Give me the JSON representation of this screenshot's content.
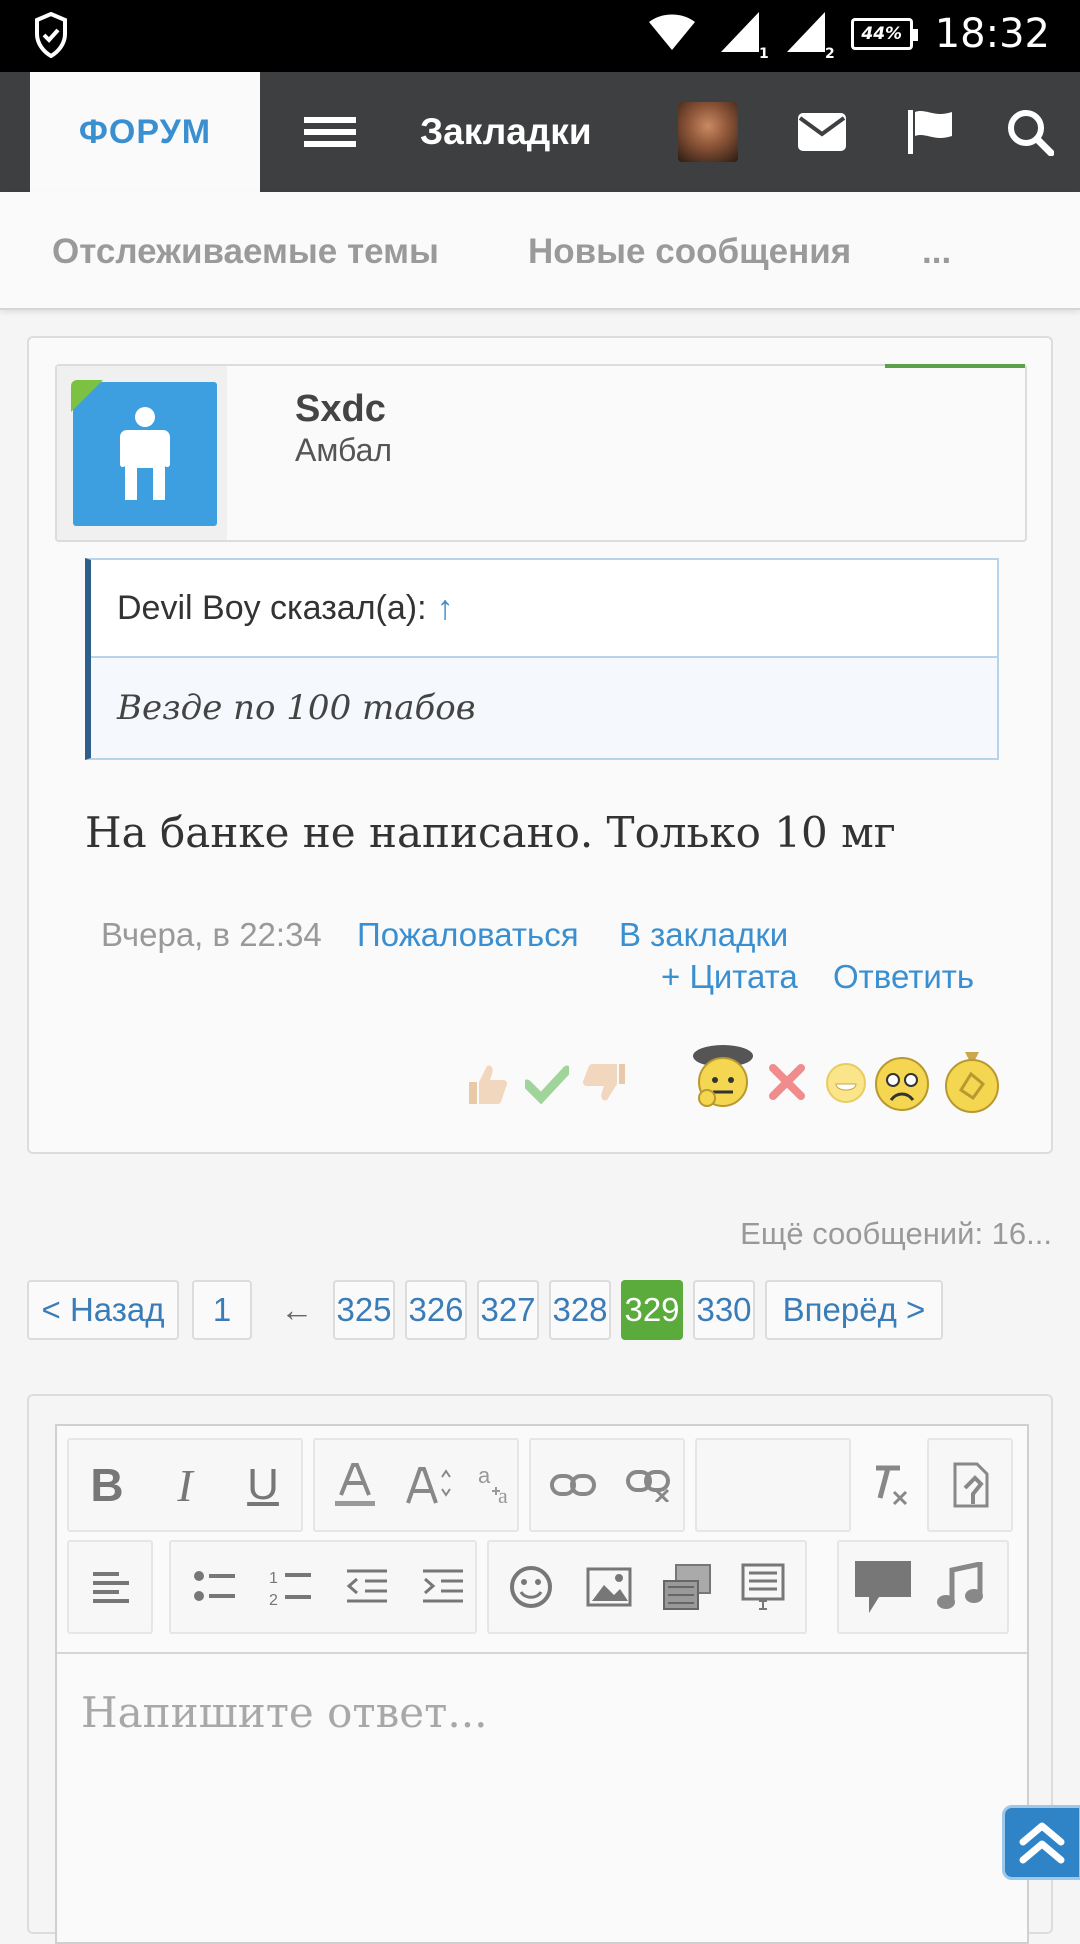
{
  "status_bar": {
    "time": "18:32",
    "battery": "44%",
    "sim1": "1",
    "sim2": "2",
    "icons": [
      "shield-check-icon",
      "wifi-icon",
      "signal-icon",
      "battery-icon"
    ]
  },
  "nav": {
    "forum_tab": "ФОРУМ",
    "bookmarks": "Закладки",
    "icons": [
      "menu-icon",
      "avatar",
      "mail-icon",
      "flag-icon",
      "search-icon"
    ]
  },
  "subnav": {
    "watched": "Отслеживаемые темы",
    "new_messages": "Новые сообщения",
    "more": "..."
  },
  "post": {
    "username": "Sxdc",
    "user_title": "Амбал",
    "quote_author": "Devil Boy сказал(а):",
    "quote_arrow": "↑",
    "quote_text": "Везде по 100 табов",
    "message": "На банке не написано. Только 10 мг",
    "date": "Вчера, в 22:34",
    "actions": {
      "report": "Пожаловаться",
      "bookmark": "В закладки",
      "quote": "+ Цитата",
      "reply": "Ответить"
    },
    "reactions": [
      "thumbs-up",
      "check",
      "thumbs-down",
      "thinking",
      "cross",
      "smile",
      "sad",
      "medal"
    ]
  },
  "more_messages": "Ещё сообщений: 16...",
  "pagination": {
    "prev": "< Назад",
    "first": "1",
    "ellipsis": "←",
    "pages": [
      "325",
      "326",
      "327",
      "328",
      "329",
      "330"
    ],
    "current": "329",
    "next": "Вперёд >"
  },
  "editor": {
    "placeholder": "Напишите ответ...",
    "toolbar_row1": [
      "bold",
      "italic",
      "underline",
      "text-color",
      "font-size",
      "font-family",
      "link",
      "unlink",
      "remove-format",
      "drafts"
    ],
    "toolbar_row2": [
      "align-left",
      "bullet-list",
      "numbered-list",
      "outdent",
      "indent",
      "smilies",
      "image",
      "media",
      "code-block",
      "quote",
      "music"
    ],
    "bold_glyph": "B",
    "italic_glyph": "I",
    "underline_glyph": "U"
  },
  "colors": {
    "accent": "#3a8fd0",
    "nav_bg": "#3e3f41",
    "active_page": "#5aaa3c",
    "online": "#7cc142"
  }
}
